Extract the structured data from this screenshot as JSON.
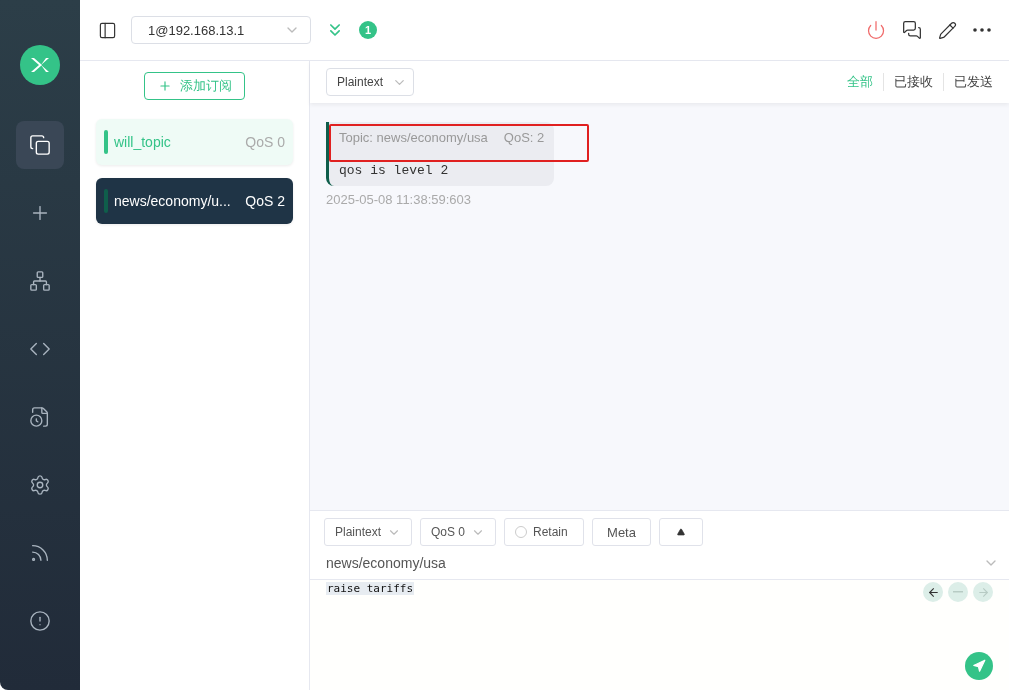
{
  "sidebar": {
    "items": [
      {
        "kind": "connections",
        "selected": true
      },
      {
        "kind": "new",
        "selected": false
      },
      {
        "kind": "topology",
        "selected": false
      },
      {
        "kind": "script",
        "selected": false
      },
      {
        "kind": "log",
        "selected": false
      },
      {
        "kind": "settings",
        "selected": false
      },
      {
        "kind": "feed",
        "selected": false
      },
      {
        "kind": "about",
        "selected": false
      }
    ]
  },
  "topbar": {
    "connection": "1@192.168.13.1",
    "badge": "1"
  },
  "subscriptions": {
    "add_button": "添加订阅",
    "items": [
      {
        "topic": "will_topic",
        "qos": "QoS 0",
        "color": "#34c388",
        "selected": false
      },
      {
        "topic": "news/economy/u...",
        "qos": "QoS 2",
        "color": "#0f5e4b",
        "selected": true
      }
    ]
  },
  "messages": {
    "format": "Plaintext",
    "filters": [
      {
        "label": "全部",
        "selected": true
      },
      {
        "label": "已接收",
        "selected": false
      },
      {
        "label": "已发送",
        "selected": false
      }
    ],
    "items": [
      {
        "topic": "Topic: news/economy/usa",
        "qos": "QoS: 2",
        "payload": "qos is level 2",
        "time": "2025-05-08 11:38:59:603",
        "annotated": true
      }
    ]
  },
  "composer": {
    "format": "Plaintext",
    "qos": "QoS 0",
    "retain": {
      "label": "Retain",
      "checked": false
    },
    "meta": "Meta",
    "topic": "news/economy/usa",
    "payload": "raise tariffs"
  }
}
